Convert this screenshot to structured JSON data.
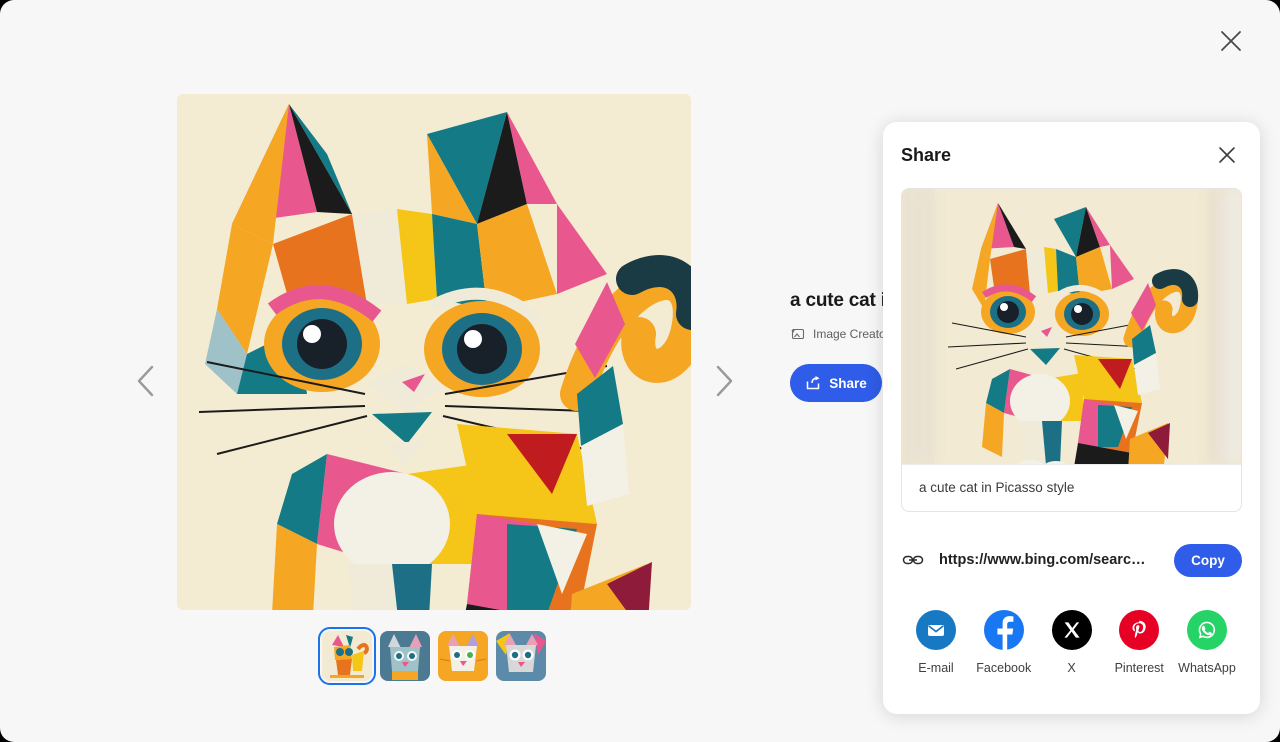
{
  "viewer": {
    "close_label": "close-viewer",
    "background_color": "#f7f7f7"
  },
  "carousel": {
    "prev_label": "Previous image",
    "next_label": "Next image",
    "selected_index": 0,
    "thumbnails": [
      {
        "alt": "Cubist cat sitting, cream background",
        "selected": true
      },
      {
        "alt": "Cubist cat face, blue background",
        "selected": false
      },
      {
        "alt": "Cubist cat face, orange background",
        "selected": false
      },
      {
        "alt": "Cubist cat face, grey and blue",
        "selected": false
      }
    ]
  },
  "detail": {
    "title": "a cute cat i",
    "source_label": "Image Creator in",
    "source_icon": "image-sparkle-icon",
    "share_button_label": "Share",
    "share_button_icon": "share-arrow-icon",
    "accent_color": "#2f5ce8"
  },
  "share_panel": {
    "title": "Share",
    "close_icon": "close-icon",
    "caption": "a cute cat in Picasso style",
    "link": {
      "icon": "link-icon",
      "url": "https://www.bing.com/searc…",
      "copy_label": "Copy"
    },
    "socials": [
      {
        "label": "E-mail",
        "icon": "email-icon",
        "color": "#1778c4"
      },
      {
        "label": "Facebook",
        "icon": "facebook-icon",
        "color": "#1877f2"
      },
      {
        "label": "X",
        "icon": "x-icon",
        "color": "#000000"
      },
      {
        "label": "Pinterest",
        "icon": "pinterest-icon",
        "color": "#e60023"
      },
      {
        "label": "WhatsApp",
        "icon": "whatsapp-icon",
        "color": "#25d366"
      }
    ]
  }
}
